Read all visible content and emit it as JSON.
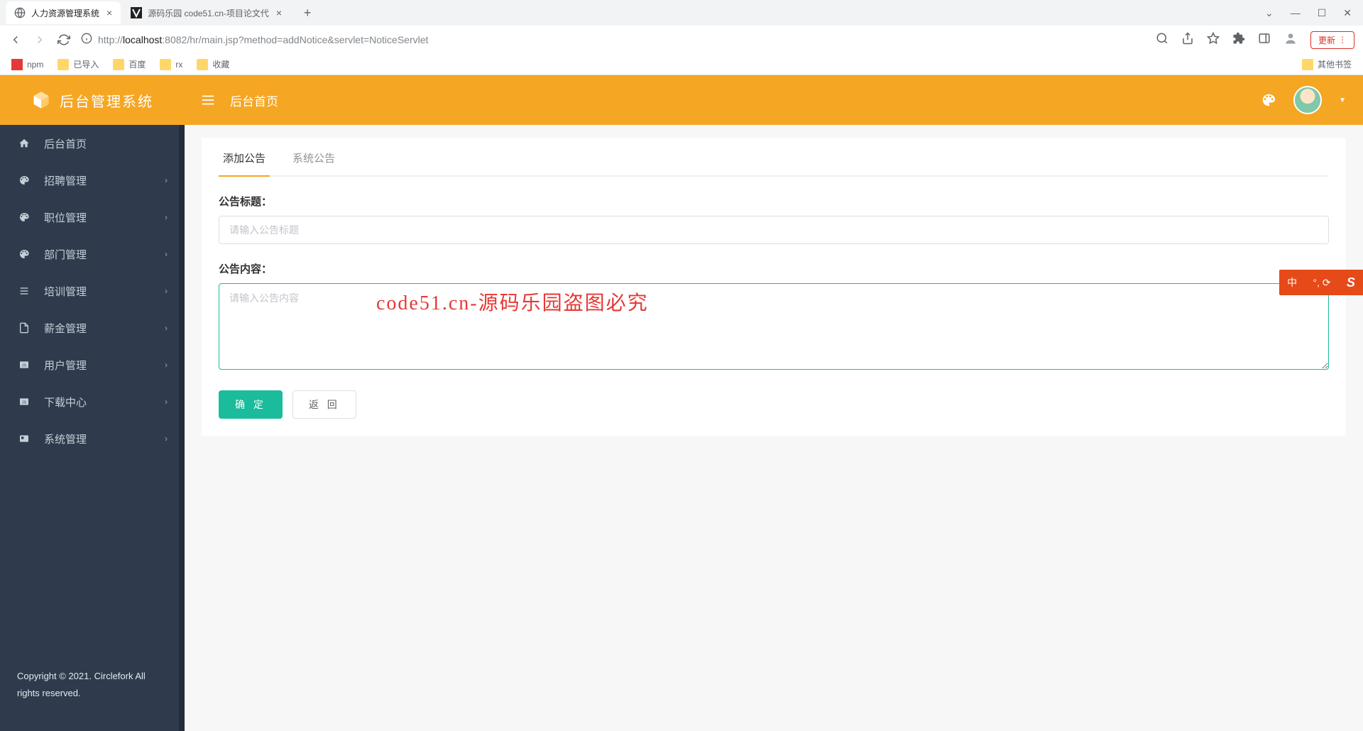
{
  "browser": {
    "tabs": [
      {
        "title": "人力资源管理系统",
        "active": true
      },
      {
        "title": "源码乐园 code51.cn-项目论文代",
        "active": false
      }
    ],
    "url_prefix": "http://",
    "url_host": "localhost",
    "url_port": ":8082",
    "url_path": "/hr/main.jsp?method=addNotice&servlet=NoticeServlet",
    "update_label": "更新",
    "bookmarks": [
      "npm",
      "已导入",
      "百度",
      "rx",
      "收藏"
    ],
    "other_bookmarks": "其他书签"
  },
  "header": {
    "logo_text": "后台管理系统",
    "title": "后台首页"
  },
  "sidebar": {
    "items": [
      {
        "label": "后台首页",
        "icon": "home",
        "expandable": false
      },
      {
        "label": "招聘管理",
        "icon": "palette",
        "expandable": true
      },
      {
        "label": "职位管理",
        "icon": "palette",
        "expandable": true
      },
      {
        "label": "部门管理",
        "icon": "palette",
        "expandable": true
      },
      {
        "label": "培训管理",
        "icon": "list",
        "expandable": true
      },
      {
        "label": "薪金管理",
        "icon": "file",
        "expandable": true
      },
      {
        "label": "用户管理",
        "icon": "js",
        "expandable": true
      },
      {
        "label": "下载中心",
        "icon": "js",
        "expandable": true
      },
      {
        "label": "系统管理",
        "icon": "card",
        "expandable": true
      }
    ],
    "footer": "Copyright © 2021. Circlefork All rights reserved."
  },
  "content": {
    "tabs": [
      {
        "label": "添加公告",
        "active": true
      },
      {
        "label": "系统公告",
        "active": false
      }
    ],
    "title_label": "公告标题：",
    "title_placeholder": "请输入公告标题",
    "body_label": "公告内容：",
    "body_placeholder": "请输入公告内容",
    "confirm": "确 定",
    "back": "返 回"
  },
  "watermark": "code51.cn-源码乐园盗图必究",
  "ime": {
    "lang": "中",
    "punct": "°,  ⟳"
  }
}
